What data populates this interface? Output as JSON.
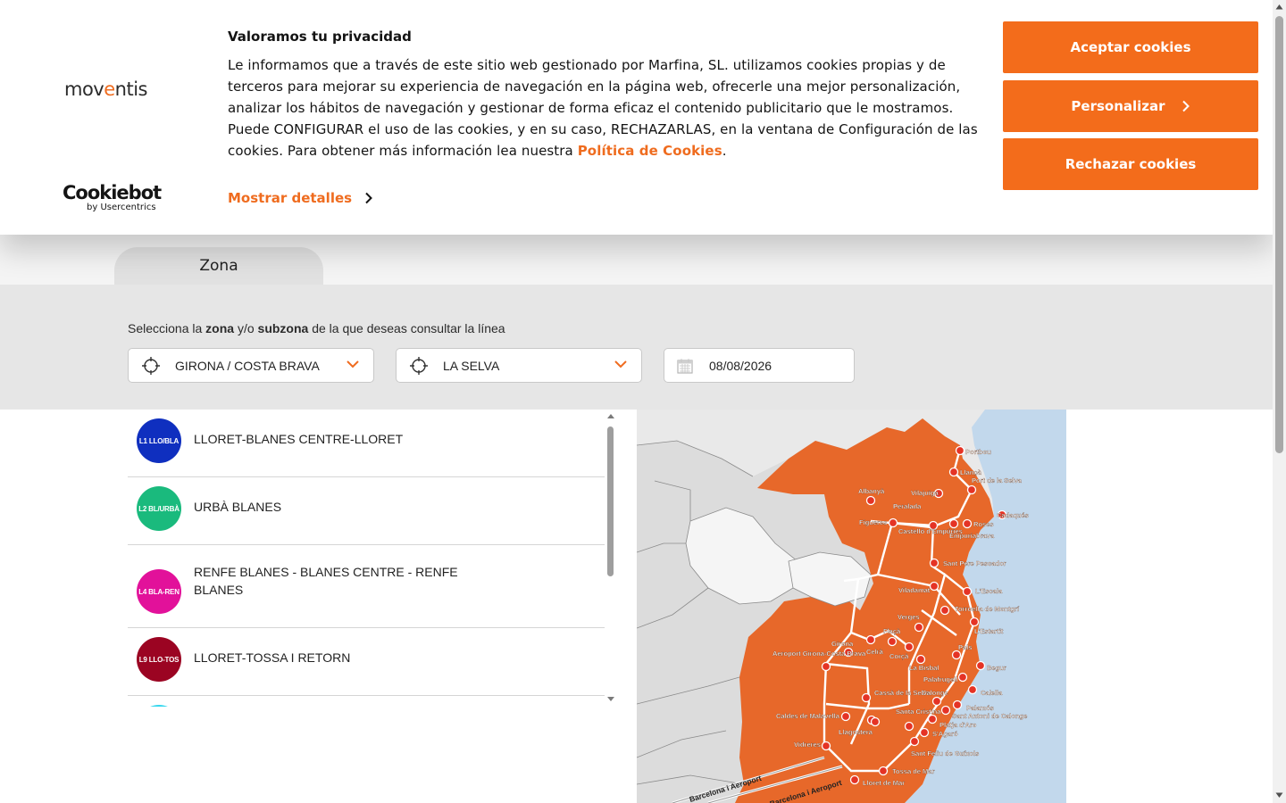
{
  "cookie_banner": {
    "brand_logo_prefix": "mov",
    "brand_logo_accent": "e",
    "brand_logo_suffix": "ntis",
    "cookiebot_name": "Cookiebot",
    "cookiebot_sub": "by Usercentrics",
    "title": "Valoramos tu privacidad",
    "text": "Le informamos que a través de este sitio web gestionado por Marfina, SL. utilizamos cookies propias y de terceros para mejorar su experiencia de navegación en la página web, ofrecerle una mejor personalización, analizar los hábitos de navegación y gestionar de forma eficaz el contenido publicitario que le mostramos. Puede CONFIGURAR el uso de las cookies, y en su caso, RECHAZARLAS, en la ventana de Configuración de las cookies. Para obtener más información lea nuestra ",
    "policy_link": "Política de Cookies",
    "text_end": ".",
    "show_details": "Mostrar detalles",
    "accept_label": "Aceptar cookies",
    "customize_label": "Personalizar",
    "reject_label": "Rechazar cookies"
  },
  "tabs": {
    "zona_label": "Zona"
  },
  "filters": {
    "caption_pre": "Selecciona la ",
    "caption_zona": "zona",
    "caption_mid": " y/o ",
    "caption_subzona": "subzona",
    "caption_post": " de la que deseas consultar la línea",
    "zone_value": "GIRONA / COSTA BRAVA",
    "subzone_value": "LA SELVA",
    "date_value": "08/08/2026"
  },
  "lines": [
    {
      "code": "L1 LLO/BLA",
      "name": "LLORET-BLANES CENTRE-LLORET",
      "color": "#0f2fbf"
    },
    {
      "code": "L2 BL/URBÀ",
      "name": "URBÀ BLANES",
      "color": "#1aba7d"
    },
    {
      "code": "L4 BLA-REN",
      "name": "RENFE BLANES - BLANES CENTRE - RENFE BLANES",
      "color": "#e2119a"
    },
    {
      "code": "L9 LLO-TOS",
      "name": "LLORET-TOSSA I RETORN",
      "color": "#9b0422"
    }
  ],
  "map": {
    "labels": [
      "Portbou",
      "Llançà",
      "Port de la Selva",
      "Cadaqués",
      "Albanyà",
      "Vilajuïga",
      "Peralada",
      "Figueres",
      "Castelló d'Empúries",
      "Roses",
      "Empuriabrava",
      "Sant Pere Pescador",
      "Viladamat",
      "L'Escala",
      "Torroella de Montgrí",
      "L'Estartit",
      "Verges",
      "Flaçà",
      "Girona",
      "Aeroport Girona-Costa Brava",
      "Celrà",
      "Corçà",
      "La Bisbal",
      "Pals",
      "Begur",
      "Palafrugell",
      "Calella",
      "Calonge",
      "Palamós",
      "Cassà de la Selva",
      "Santa Cristina",
      "Sant Antoni de Calonge",
      "Platja d'Aro",
      "S'Agaró",
      "Caldes de Malavella",
      "Llagostera",
      "Vidreres",
      "Sant Feliu de Guíxols",
      "Tossa de Mar",
      "Lloret de Mar",
      "Barcelona i Aeroport",
      "Barcelona i Aeroport"
    ],
    "colors": {
      "sea": "#c2d8ec",
      "region": "#e7682a",
      "land": "#e9e9e9",
      "stop": "#e53325"
    }
  },
  "colors": {
    "accent": "#f36c1b",
    "link": "#ef6c1f"
  }
}
